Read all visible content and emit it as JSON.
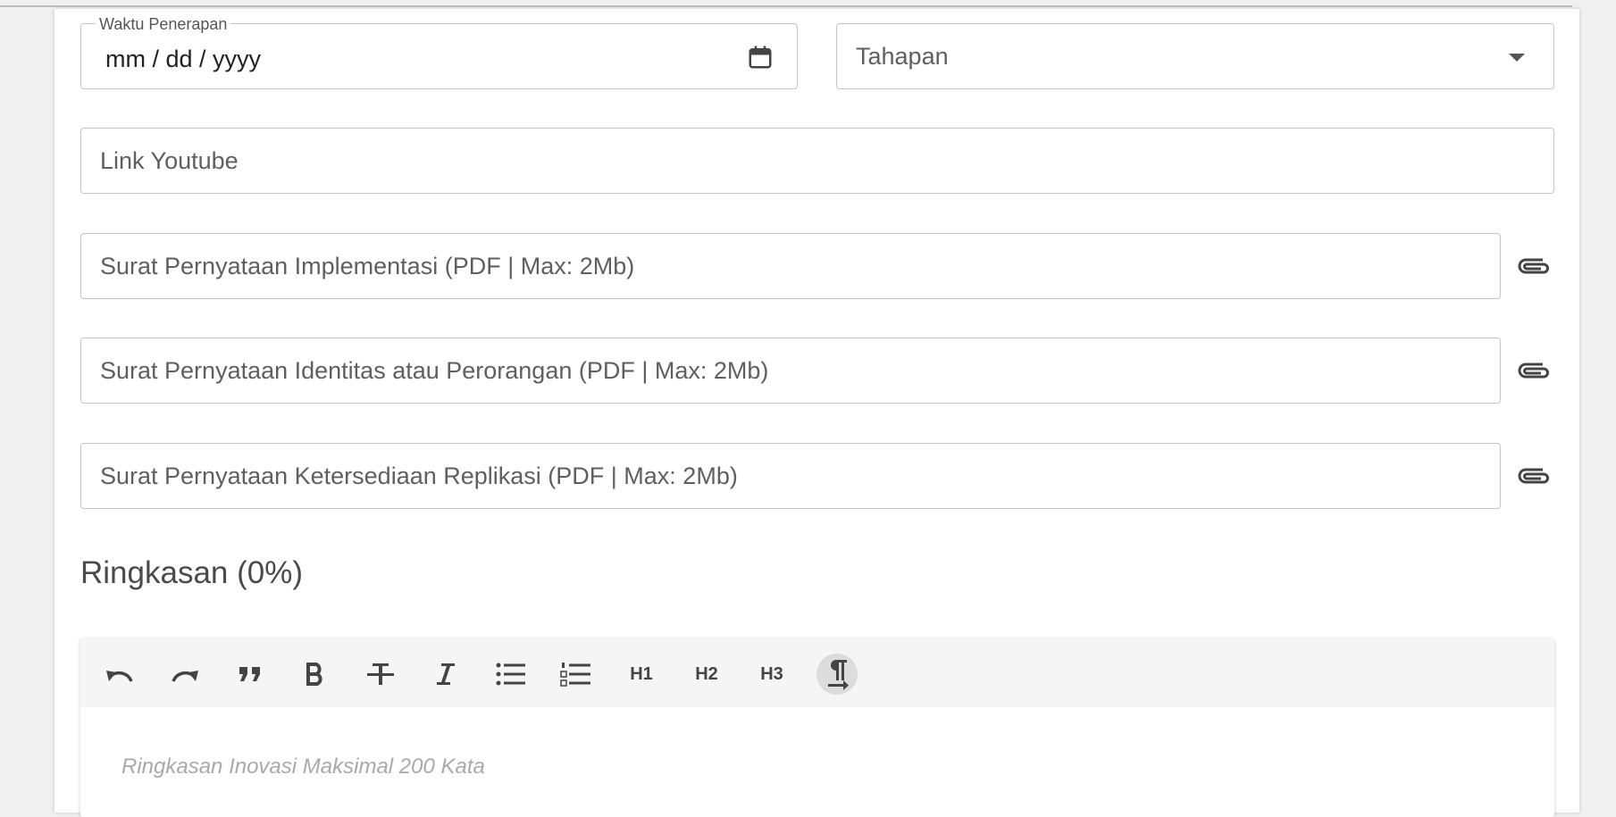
{
  "form": {
    "waktu_penerapan": {
      "label": "Waktu Penerapan",
      "value": "mm / dd / yyyy"
    },
    "tahapan": {
      "placeholder": "Tahapan"
    },
    "link_youtube": {
      "placeholder": "Link Youtube"
    },
    "uploads": [
      {
        "placeholder": "Surat Pernyataan Implementasi (PDF | Max: 2Mb)"
      },
      {
        "placeholder": "Surat Pernyataan Identitas atau Perorangan (PDF | Max: 2Mb)"
      },
      {
        "placeholder": "Surat Pernyataan Ketersediaan Replikasi (PDF | Max: 2Mb)"
      }
    ]
  },
  "ringkasan": {
    "title": "Ringkasan (0%)",
    "editor": {
      "toolbar": [
        "undo-icon",
        "redo-icon",
        "quote-icon",
        "bold-icon",
        "strikethrough-icon",
        "italic-icon",
        "bullet-list-icon",
        "ordered-list-icon",
        "H1",
        "H2",
        "H3",
        "paragraph-icon"
      ],
      "h1": "H1",
      "h2": "H2",
      "h3": "H3",
      "placeholder": "Ringkasan Inovasi Maksimal 200 Kata"
    }
  },
  "colors": {
    "border": "#c4c4c4",
    "toolbar_bg": "#f5f5f5",
    "active_btn": "#dcdcdc"
  }
}
